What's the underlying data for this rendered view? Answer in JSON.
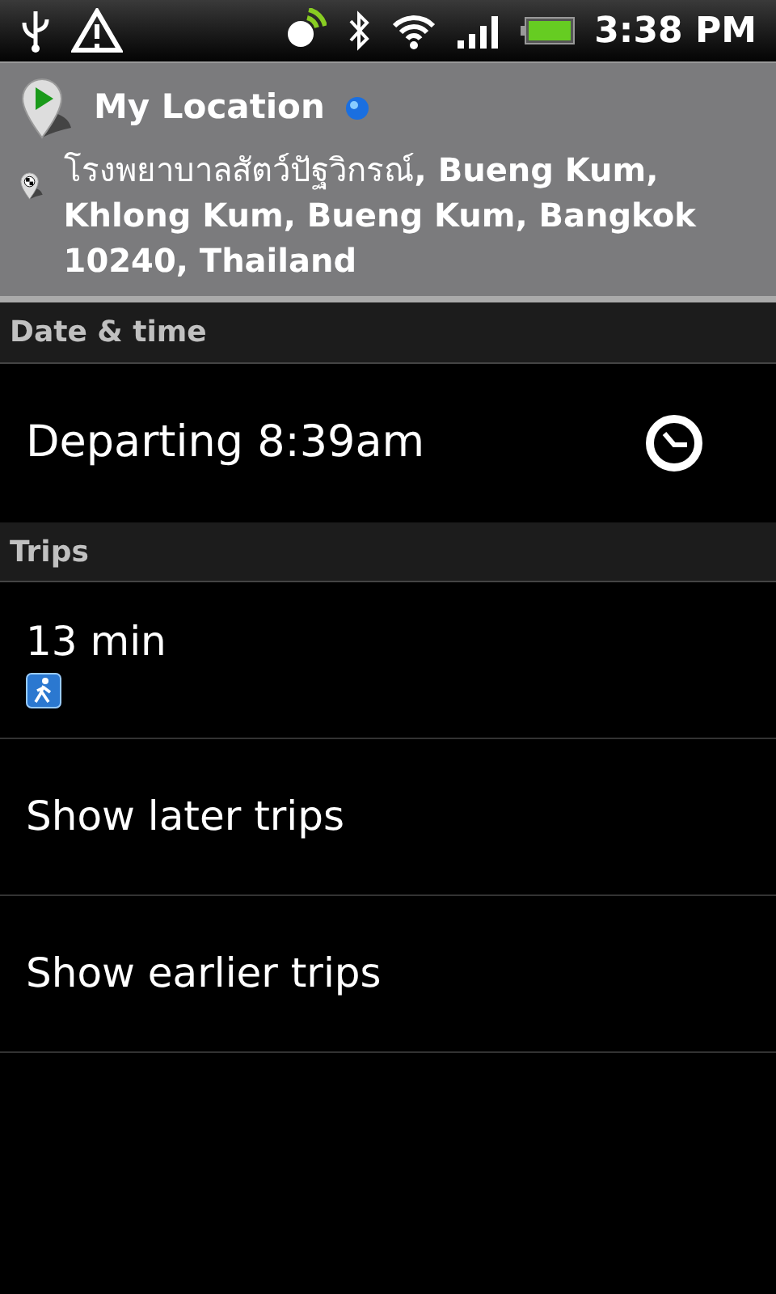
{
  "status_bar": {
    "time": "3:38 PM"
  },
  "route": {
    "origin": "My Location",
    "destination": "โรงพยาบาลสัตว์ปัฐวิกรณ์**, Bueng Kum, Khlong Kum, Bueng Kum, Bangkok 10240, Thailand**"
  },
  "date_time": {
    "header": "Date & time",
    "label": "Departing 8:39am"
  },
  "trips": {
    "header": "Trips",
    "items": [
      {
        "kind": "trip",
        "label": "13 min"
      },
      {
        "kind": "action",
        "label": "Show later trips"
      },
      {
        "kind": "action",
        "label": "Show earlier trips"
      }
    ]
  }
}
